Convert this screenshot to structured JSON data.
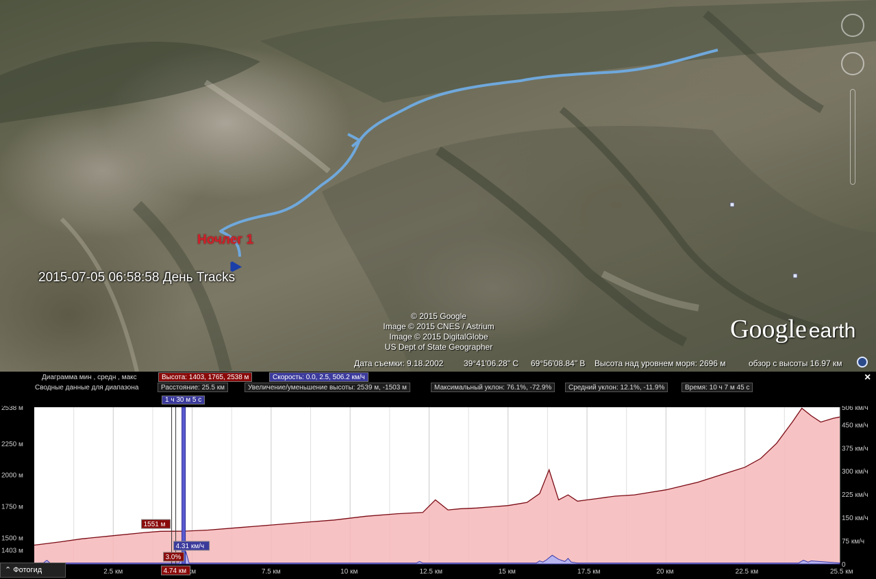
{
  "map": {
    "track_label": "2015-07-05 06:58:58 День   Tracks",
    "placemark_label": "Ночлег 1",
    "attribution": [
      "© 2015 Google",
      "Image © 2015 CNES / Astrium",
      "Image © 2015 DigitalGlobe",
      "US Dept of State Geographer"
    ],
    "logo_google": "Google",
    "logo_earth": "earth",
    "status": {
      "date": "Дата съемки: 9.18.2002",
      "lat": "39°41'06.28\" С",
      "lon": "69°56'08.84\" В",
      "elevation": "Высота над уровнем моря:  2696 м",
      "eye_alt": "обзор с высоты  16.97 км"
    },
    "track_color": "#6fa8dc"
  },
  "panel": {
    "row1_label": "Диаграмма  мин , средн , макс",
    "row2_label": "Сводные данные для диапазона",
    "height_chip": "Высота: 1403, 1765, 2538 м",
    "speed_chip": "Скорость: 0.0, 2.5, 506.2 км/ч",
    "distance_chip": "Расстояние: 25.5 км",
    "gain_chip": "Увеличение/уменьшение высоты: 2539 м, -1503 м",
    "max_slope_chip": "Максимальный уклон: 76.1%, -72.9%",
    "avg_slope_chip": "Средний уклон: 12.1%, -11.9%",
    "time_chip": "Время: 10 ч 7 м 45 с",
    "close": "×",
    "photo_button": "Фотогид",
    "cursor": {
      "time": "1 ч 30 м 5 с",
      "height": "1551 м",
      "slope": "3.0%",
      "speed": "4.31 км/ч",
      "distance": "4.74 км"
    }
  },
  "chart_data": {
    "type": "line",
    "xlabel": "",
    "x_ticks": [
      "2.5 км",
      "5 км",
      "7.5 км",
      "10 км",
      "12.5 км",
      "15 км",
      "17.5 км",
      "20 км",
      "22.5 км",
      "25.5 км"
    ],
    "x_tick_values": [
      2.5,
      5,
      7.5,
      10,
      12.5,
      15,
      17.5,
      20,
      22.5,
      25.5
    ],
    "xlim": [
      0,
      25.5
    ],
    "y_left_ticks": [
      "2538 м",
      "2250 м",
      "2000 м",
      "1750 м",
      "1500 м",
      "1403 м"
    ],
    "y_left_values": [
      2538,
      2250,
      2000,
      1750,
      1500,
      1403
    ],
    "ylim_left": [
      1290,
      2538
    ],
    "y_right_ticks": [
      "506 км/ч",
      "450 км/ч",
      "375 км/ч",
      "300 км/ч",
      "225 км/ч",
      "150 км/ч",
      "75 км/ч",
      "0"
    ],
    "y_right_values": [
      506,
      450,
      375,
      300,
      225,
      150,
      75,
      0
    ],
    "ylim_right": [
      0,
      506
    ],
    "series": [
      {
        "name": "Высота",
        "color": "#7a0a14",
        "fill": "#f6b7b9",
        "x": [
          0,
          0.8,
          1.5,
          2.5,
          3.5,
          4.0,
          4.74,
          5.5,
          6.5,
          7.5,
          8.5,
          9.5,
          10.5,
          11.5,
          12.3,
          12.7,
          13.1,
          13.5,
          14.0,
          14.5,
          15.0,
          15.6,
          16.0,
          16.3,
          16.6,
          16.9,
          17.2,
          17.5,
          17.8,
          18.1,
          18.4,
          19.0,
          19.5,
          20.0,
          20.5,
          21.0,
          21.5,
          22.0,
          22.5,
          23.0,
          23.5,
          24.0,
          24.3,
          24.6,
          24.9,
          25.3,
          25.5
        ],
        "values": [
          1440,
          1465,
          1490,
          1515,
          1540,
          1550,
          1551,
          1560,
          1580,
          1600,
          1620,
          1640,
          1670,
          1690,
          1700,
          1800,
          1720,
          1730,
          1735,
          1745,
          1755,
          1780,
          1850,
          2040,
          1800,
          1840,
          1790,
          1800,
          1810,
          1820,
          1830,
          1840,
          1860,
          1880,
          1910,
          1940,
          1980,
          2020,
          2060,
          2130,
          2250,
          2420,
          2530,
          2470,
          2420,
          2450,
          2460
        ]
      },
      {
        "name": "Скорость",
        "color": "#3b3aaa",
        "fill": "#b8b4ee",
        "x": [
          0,
          0.3,
          0.4,
          0.5,
          1.0,
          4.6,
          4.7,
          4.74,
          4.8,
          4.9,
          12.1,
          12.2,
          12.3,
          15.9,
          16.0,
          16.1,
          16.2,
          16.4,
          16.6,
          16.8,
          16.9,
          17.0,
          17.2,
          24.2,
          24.35,
          24.5,
          24.6,
          25.5
        ],
        "values": [
          3,
          4,
          12,
          3,
          3,
          3,
          40,
          4,
          40,
          3,
          3,
          8,
          3,
          3,
          10,
          6,
          12,
          28,
          15,
          8,
          18,
          6,
          3,
          3,
          12,
          6,
          10,
          3
        ]
      }
    ]
  }
}
